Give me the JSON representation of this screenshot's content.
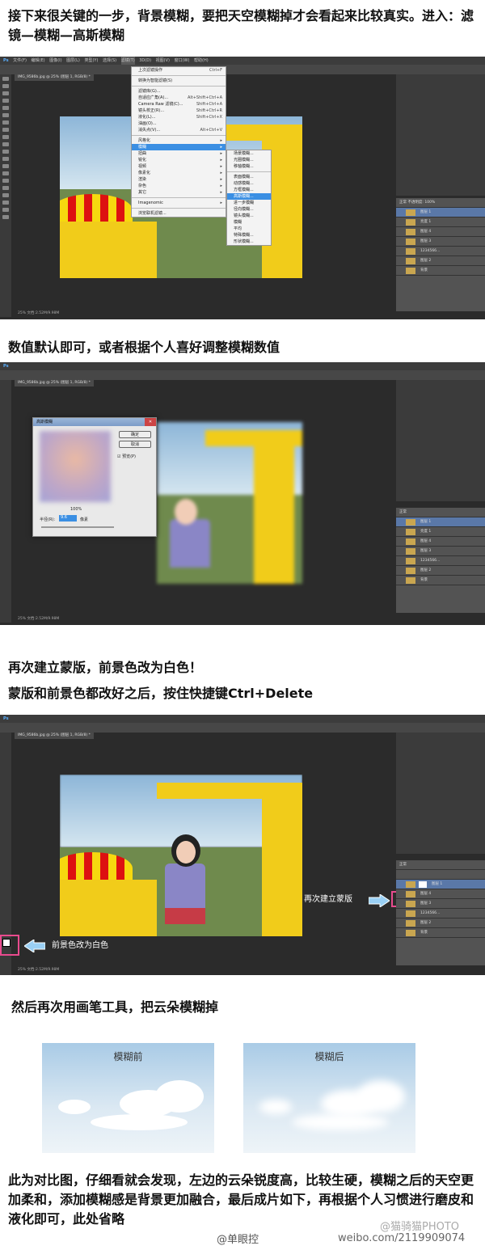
{
  "paragraphs": {
    "p1": "接下来很关键的一步，背景模糊，要把天空模糊掉才会看起来比较真实。进入：滤镜—模糊—高斯模糊",
    "p2": "数值默认即可，或者根据个人喜好调整模糊数值",
    "p3": "再次建立蒙版，前景色改为白色！",
    "p4": "蒙版和前景色都改好之后，按住快捷键Ctrl+Delete",
    "p5": "然后再次用画笔工具，把云朵模糊掉",
    "p6": "此为对比图，仔细看就会发现，左边的云朵锐度高，比较生硬，模糊之后的天空更加柔和，添加模糊感是背景更加融合，最后成片如下，再根据个人习惯进行磨皮和液化即可，此处省略"
  },
  "ps": {
    "menubar_items": [
      "Ps",
      "文件(F)",
      "编辑(E)",
      "图像(I)",
      "图层(L)",
      "类型(Y)",
      "选择(S)",
      "滤镜(T)",
      "3D(D)",
      "视图(V)",
      "窗口(W)",
      "帮助(H)"
    ],
    "doc_tab": "IMG_9586b.jpg @ 25% (图层 1, RGB/8) *",
    "status": "25%   文档:2.52M/9.98M"
  },
  "filter_menu": {
    "items": [
      "上次滤镜操作",
      "转换为智能滤镜(S)",
      "滤镜库(G)...",
      "自适应广角(A)...",
      "Camera Raw 滤镜(C)...",
      "镜头校正(R)...",
      "液化(L)...",
      "油画(O)...",
      "消失点(V)...",
      "风格化",
      "模糊",
      "扭曲",
      "锐化",
      "视频",
      "像素化",
      "渲染",
      "杂色",
      "其它",
      "Imagenomic",
      "浏览联机滤镜..."
    ],
    "shortcuts": [
      "Ctrl+F",
      "",
      "",
      "Alt+Shift+Ctrl+A",
      "Shift+Ctrl+A",
      "Shift+Ctrl+R",
      "Shift+Ctrl+X",
      "",
      "Alt+Ctrl+V"
    ],
    "blur_items": [
      "场景模糊...",
      "光圈模糊...",
      "移轴模糊...",
      "表面模糊...",
      "动感模糊...",
      "方框模糊...",
      "高斯模糊...",
      "进一步模糊",
      "径向模糊...",
      "镜头模糊...",
      "模糊",
      "平均",
      "特殊模糊...",
      "形状模糊..."
    ]
  },
  "dialog": {
    "title": "高斯模糊",
    "ok": "确定",
    "cancel": "取消",
    "preview": "预览(P)",
    "zoom": "100%",
    "radius_label": "半径(R):",
    "radius_value": "9.6",
    "radius_unit": "像素"
  },
  "layers_panel": {
    "blend": "正常",
    "opacity_label": "不透明度:",
    "opacity": "100%",
    "fill_label": "填充:",
    "fill": "100%",
    "rows1": [
      "图层 1",
      "亮度 1",
      "图层 4",
      "图层 3",
      "1234566...",
      "图层 2",
      "背景"
    ],
    "rows3": [
      "图层 1",
      "图层 4",
      "图层 3",
      "1234566...",
      "图层 2",
      "背景"
    ]
  },
  "callouts": {
    "new_mask": "再次建立蒙版",
    "foreground_white": "前景色改为白色"
  },
  "compare": {
    "before": "模糊前",
    "after": "模糊后"
  },
  "watermarks": {
    "credit": "@单眼控",
    "weibo_name": "@猫骑猫PHOTO",
    "weibo_url": "weibo.com/2119909074"
  }
}
